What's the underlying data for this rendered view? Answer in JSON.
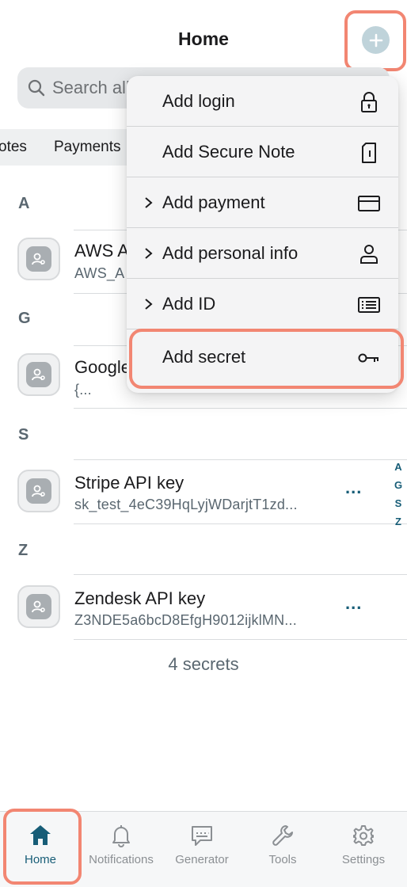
{
  "header": {
    "title": "Home",
    "add_icon": "plus-icon"
  },
  "search": {
    "placeholder": "Search all"
  },
  "filters": [
    "otes",
    "Payments"
  ],
  "sections": [
    {
      "letter": "A",
      "items": [
        {
          "title": "AWS A",
          "subtitle": "AWS_A",
          "icon": "secret-icon"
        }
      ]
    },
    {
      "letter": "G",
      "items": [
        {
          "title": "Google",
          "subtitle": "{...",
          "icon": "secret-icon"
        }
      ]
    },
    {
      "letter": "S",
      "items": [
        {
          "title": "Stripe API key",
          "subtitle": "sk_test_4eC39HqLyjWDarjtT1zd...",
          "icon": "secret-icon",
          "more": "..."
        }
      ]
    },
    {
      "letter": "Z",
      "items": [
        {
          "title": "Zendesk API key",
          "subtitle": "Z3NDE5a6bcD8EfgH9012ijklMN...",
          "icon": "secret-icon",
          "more": "..."
        }
      ]
    }
  ],
  "alphabet_index": [
    "A",
    "G",
    "S",
    "Z"
  ],
  "count_text": "4 secrets",
  "menu": {
    "items": [
      {
        "label": "Add login",
        "icon": "lock-icon",
        "submenu": false
      },
      {
        "label": "Add Secure Note",
        "icon": "note-icon",
        "submenu": false
      },
      {
        "label": "Add payment",
        "icon": "card-icon",
        "submenu": true
      },
      {
        "label": "Add personal info",
        "icon": "person-icon",
        "submenu": true
      },
      {
        "label": "Add ID",
        "icon": "id-card-icon",
        "submenu": true
      },
      {
        "label": "Add secret",
        "icon": "key-icon",
        "submenu": false
      }
    ]
  },
  "tabs": [
    {
      "label": "Home",
      "icon": "home-icon",
      "active": true
    },
    {
      "label": "Notifications",
      "icon": "bell-icon",
      "active": false
    },
    {
      "label": "Generator",
      "icon": "generator-icon",
      "active": false
    },
    {
      "label": "Tools",
      "icon": "wrench-icon",
      "active": false
    },
    {
      "label": "Settings",
      "icon": "gear-icon",
      "active": false
    }
  ],
  "colors": {
    "accent": "#175d77",
    "highlight": "#f28672",
    "add_button": "#bfd3da"
  }
}
